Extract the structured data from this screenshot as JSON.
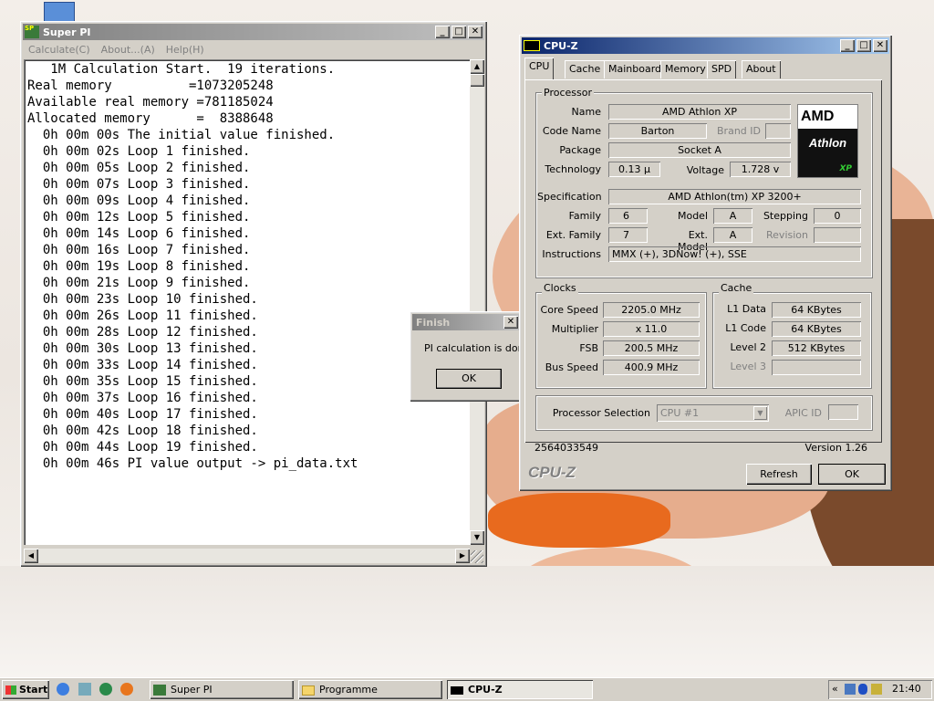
{
  "superpi": {
    "title": "Super PI",
    "menu": [
      "Calculate(C)",
      "About...(A)",
      "Help(H)"
    ],
    "lines": [
      "   1M Calculation Start.  19 iterations.",
      "Real memory          =1073205248",
      "Available real memory =781185024",
      "Allocated memory      =  8388648",
      "  0h 00m 00s The initial value finished.",
      "  0h 00m 02s Loop 1 finished.",
      "  0h 00m 05s Loop 2 finished.",
      "  0h 00m 07s Loop 3 finished.",
      "  0h 00m 09s Loop 4 finished.",
      "  0h 00m 12s Loop 5 finished.",
      "  0h 00m 14s Loop 6 finished.",
      "  0h 00m 16s Loop 7 finished.",
      "  0h 00m 19s Loop 8 finished.",
      "  0h 00m 21s Loop 9 finished.",
      "  0h 00m 23s Loop 10 finished.",
      "  0h 00m 26s Loop 11 finished.",
      "  0h 00m 28s Loop 12 finished.",
      "  0h 00m 30s Loop 13 finished.",
      "  0h 00m 33s Loop 14 finished.",
      "  0h 00m 35s Loop 15 finished.",
      "  0h 00m 37s Loop 16 finished.",
      "  0h 00m 40s Loop 17 finished.",
      "  0h 00m 42s Loop 18 finished.",
      "  0h 00m 44s Loop 19 finished.",
      "  0h 00m 46s PI value output -> pi_data.txt"
    ]
  },
  "finish_dialog": {
    "title": "Finish",
    "message": "PI calculation is done",
    "ok": "OK"
  },
  "cpuz": {
    "title": "CPU-Z",
    "tabs": [
      "CPU",
      "Cache",
      "Mainboard",
      "Memory",
      "SPD",
      "About"
    ],
    "processor": {
      "group": "Processor",
      "name_label": "Name",
      "name": "AMD Athlon XP",
      "codename_label": "Code Name",
      "codename": "Barton",
      "brandid_label": "Brand ID",
      "package_label": "Package",
      "package": "Socket A",
      "technology_label": "Technology",
      "technology": "0.13 µ",
      "voltage_label": "Voltage",
      "voltage": "1.728 v",
      "spec_label": "Specification",
      "spec": "AMD Athlon(tm) XP 3200+",
      "family_label": "Family",
      "family": "6",
      "model_label": "Model",
      "model": "A",
      "stepping_label": "Stepping",
      "stepping": "0",
      "extfamily_label": "Ext. Family",
      "extfamily": "7",
      "extmodel_label": "Ext. Model",
      "extmodel": "A",
      "revision_label": "Revision",
      "instructions_label": "Instructions",
      "instructions": "MMX (+), 3DNow! (+), SSE"
    },
    "logo": {
      "brand": "AMD",
      "line": "Athlon",
      "suffix": "XP"
    },
    "clocks": {
      "group": "Clocks",
      "core_label": "Core Speed",
      "core": "2205.0 MHz",
      "mult_label": "Multiplier",
      "mult": "x 11.0",
      "fsb_label": "FSB",
      "fsb": "200.5 MHz",
      "bus_label": "Bus Speed",
      "bus": "400.9 MHz"
    },
    "cache": {
      "group": "Cache",
      "l1d_label": "L1 Data",
      "l1d": "64 KBytes",
      "l1c_label": "L1 Code",
      "l1c": "64 KBytes",
      "l2_label": "Level 2",
      "l2": "512 KBytes",
      "l3_label": "Level 3"
    },
    "selection_label": "Processor Selection",
    "selection": "CPU #1",
    "apic_label": "APIC ID",
    "serial": "2564033549",
    "version": "Version 1.26",
    "brand": "CPU-Z",
    "refresh": "Refresh",
    "ok": "OK"
  },
  "taskbar": {
    "start": "Start",
    "items": [
      "Super PI",
      "Programme",
      "CPU-Z"
    ],
    "clock": "21:40"
  },
  "colors": {
    "title_active": "#0a246a",
    "title_inactive": "#808080",
    "amd_green": "#008000"
  }
}
